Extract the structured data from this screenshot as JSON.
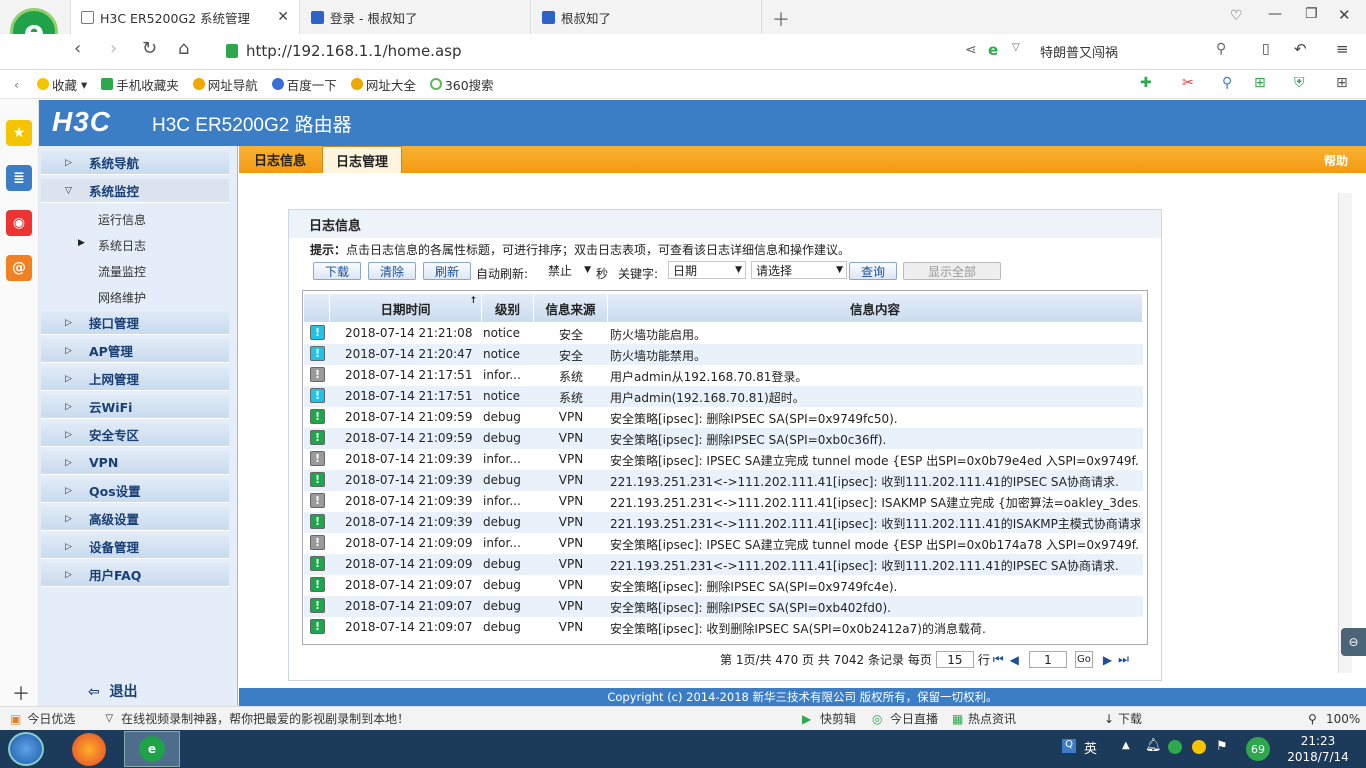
{
  "browser": {
    "tabs": [
      {
        "label": "H3C ER5200G2 系统管理"
      },
      {
        "label": "登录 - 根叔知了"
      },
      {
        "label": "根叔知了"
      }
    ],
    "url": "http://192.168.1.1/home.asp",
    "search_text": "特朗普又闯祸",
    "bookmarks": [
      "收藏",
      "手机收藏夹",
      "网址导航",
      "百度一下",
      "网址大全",
      "360搜索"
    ],
    "status_left": "今日优选",
    "status_ad": "在线视频录制神器，帮你把最爱的影视剧录制到本地！",
    "status_right": [
      "快剪辑",
      "今日直播",
      "热点资讯",
      "下载",
      "100%"
    ]
  },
  "router": {
    "logo": "H3C",
    "title": "H3C ER5200G2 路由器",
    "menu": [
      "系统导航",
      "系统监控",
      "接口管理",
      "AP管理",
      "上网管理",
      "云WiFi",
      "安全专区",
      "VPN",
      "Qos设置",
      "高级设置",
      "设备管理",
      "用户FAQ"
    ],
    "submenu": [
      "运行信息",
      "系统日志",
      "流量监控",
      "网络维护"
    ],
    "logout": "退出",
    "tabs": [
      "日志信息",
      "日志管理"
    ],
    "help": "帮助",
    "panel_title": "日志信息",
    "hint_bold": "提示：",
    "hint": "点击日志信息的各属性标题，可进行排序；双击日志表项，可查看该日志详细信息和操作建议。",
    "buttons": {
      "download": "下载",
      "clear": "清除",
      "refresh": "刷新",
      "auto_refresh": "自动刷新:",
      "auto_value": "禁止",
      "sec": "秒",
      "keyword": "关键字:",
      "kw_value": "日期",
      "select": "请选择",
      "query": "查询",
      "show_all": "显示全部"
    },
    "columns": [
      "日期时间",
      "级别",
      "信息来源",
      "信息内容"
    ],
    "rows": [
      {
        "icon": "blue",
        "time": "2018-07-14 21:21:08",
        "level": "notice",
        "src": "安全",
        "msg": "防火墙功能启用。"
      },
      {
        "icon": "blue",
        "time": "2018-07-14 21:20:47",
        "level": "notice",
        "src": "安全",
        "msg": "防火墙功能禁用。"
      },
      {
        "icon": "gray",
        "time": "2018-07-14 21:17:51",
        "level": "infor...",
        "src": "系统",
        "msg": "用户admin从192.168.70.81登录。"
      },
      {
        "icon": "blue",
        "time": "2018-07-14 21:17:51",
        "level": "notice",
        "src": "系统",
        "msg": "用户admin(192.168.70.81)超时。"
      },
      {
        "icon": "green",
        "time": "2018-07-14 21:09:59",
        "level": "debug",
        "src": "VPN",
        "msg": "安全策略[ipsec]: 删除IPSEC SA(SPI=0x9749fc50)."
      },
      {
        "icon": "green",
        "time": "2018-07-14 21:09:59",
        "level": "debug",
        "src": "VPN",
        "msg": "安全策略[ipsec]: 删除IPSEC SA(SPI=0xb0c36ff)."
      },
      {
        "icon": "gray",
        "time": "2018-07-14 21:09:39",
        "level": "infor...",
        "src": "VPN",
        "msg": "安全策略[ipsec]: IPSEC SA建立完成 tunnel mode {ESP 出SPI=0x0b79e4ed 入SPI=0x9749f..."
      },
      {
        "icon": "green",
        "time": "2018-07-14 21:09:39",
        "level": "debug",
        "src": "VPN",
        "msg": "221.193.251.231<->111.202.111.41[ipsec]: 收到111.202.111.41的IPSEC SA协商请求."
      },
      {
        "icon": "gray",
        "time": "2018-07-14 21:09:39",
        "level": "infor...",
        "src": "VPN",
        "msg": "221.193.251.231<->111.202.111.41[ipsec]: ISAKMP SA建立完成 {加密算法=oakley_3des..."
      },
      {
        "icon": "green",
        "time": "2018-07-14 21:09:39",
        "level": "debug",
        "src": "VPN",
        "msg": "221.193.251.231<->111.202.111.41[ipsec]: 收到111.202.111.41的ISAKMP主模式协商请求."
      },
      {
        "icon": "gray",
        "time": "2018-07-14 21:09:09",
        "level": "infor...",
        "src": "VPN",
        "msg": "安全策略[ipsec]: IPSEC SA建立完成 tunnel mode {ESP 出SPI=0x0b174a78 入SPI=0x9749f..."
      },
      {
        "icon": "green",
        "time": "2018-07-14 21:09:09",
        "level": "debug",
        "src": "VPN",
        "msg": "221.193.251.231<->111.202.111.41[ipsec]: 收到111.202.111.41的IPSEC SA协商请求."
      },
      {
        "icon": "green",
        "time": "2018-07-14 21:09:07",
        "level": "debug",
        "src": "VPN",
        "msg": "安全策略[ipsec]: 删除IPSEC SA(SPI=0x9749fc4e)."
      },
      {
        "icon": "green",
        "time": "2018-07-14 21:09:07",
        "level": "debug",
        "src": "VPN",
        "msg": "安全策略[ipsec]: 删除IPSEC SA(SPI=0xb402fd0)."
      },
      {
        "icon": "green",
        "time": "2018-07-14 21:09:07",
        "level": "debug",
        "src": "VPN",
        "msg": "安全策略[ipsec]: 收到删除IPSEC SA(SPI=0x0b2412a7)的消息载荷."
      }
    ],
    "pager": {
      "text": "第 1页/共 470 页 共 7042 条记录 每页",
      "per_page": "15",
      "unit": "行",
      "page": "1",
      "go": "Go"
    },
    "copyright": "Copyright (c) 2014-2018 新华三技术有限公司 版权所有，保留一切权利。"
  },
  "taskbar": {
    "ime": "英",
    "badge": "69",
    "time": "21:23",
    "date": "2018/7/14"
  },
  "colors": {
    "header": "#3b7ec6",
    "tabbar": "#f5a623",
    "icon_blue": "#1ec5e6",
    "icon_gray": "#9a9a9a",
    "icon_green": "#1aa84a"
  }
}
